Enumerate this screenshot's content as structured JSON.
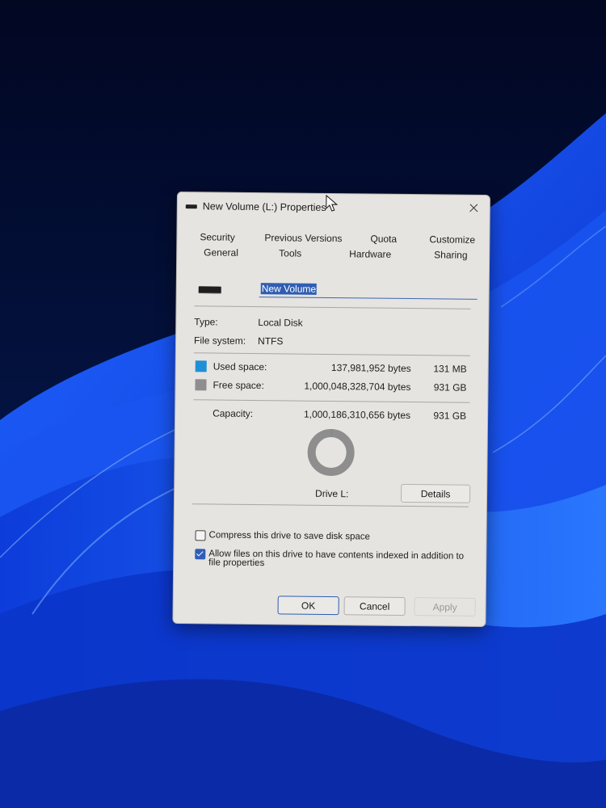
{
  "dialog": {
    "title": "New Volume (L:) Properties",
    "tabs_row1": [
      "Security",
      "Previous Versions",
      "Quota",
      "Customize"
    ],
    "tabs_row2": [
      "General",
      "Tools",
      "Hardware",
      "Sharing"
    ],
    "active_tab": "General",
    "volume_name": "New Volume",
    "type_label": "Type:",
    "type_value": "Local Disk",
    "fs_label": "File system:",
    "fs_value": "NTFS",
    "used_label": "Used space:",
    "used_bytes": "137,981,952 bytes",
    "used_size": "131 MB",
    "free_label": "Free space:",
    "free_bytes": "1,000,048,328,704 bytes",
    "free_size": "931 GB",
    "capacity_label": "Capacity:",
    "capacity_bytes": "1,000,186,310,656 bytes",
    "capacity_size": "931 GB",
    "drive_label": "Drive L:",
    "details_label": "Details",
    "compress_label": "Compress this drive to save disk space",
    "compress_checked": false,
    "index_label_line1": "Allow files on this drive to have contents indexed in addition to",
    "index_label_line2": "file properties",
    "index_checked": true,
    "ok_label": "OK",
    "cancel_label": "Cancel",
    "apply_label": "Apply",
    "colors": {
      "used": "#1f8fd6",
      "free": "#8e8e8e",
      "accent": "#2e5eb8"
    },
    "usage": {
      "used_fraction": 0.000138
    }
  }
}
